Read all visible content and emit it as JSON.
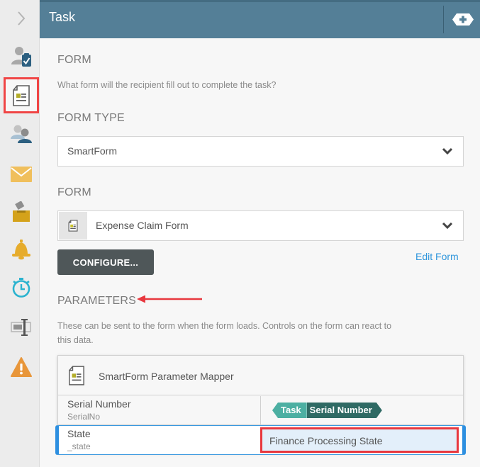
{
  "header": {
    "title": "Task",
    "add_button": "add-icon"
  },
  "sidebar": {
    "toggle": "chevron-right-icon",
    "items": [
      {
        "icon": "user-task-icon",
        "active": false
      },
      {
        "icon": "form-icon",
        "active": true
      },
      {
        "icon": "users-icon",
        "active": false
      },
      {
        "icon": "email-icon",
        "active": false
      },
      {
        "icon": "inbox-icon",
        "active": false
      },
      {
        "icon": "bell-icon",
        "active": false
      },
      {
        "icon": "stopwatch-icon",
        "active": false
      },
      {
        "icon": "text-field-icon",
        "active": false
      },
      {
        "icon": "warning-icon",
        "active": false
      }
    ]
  },
  "form_section": {
    "title": "FORM",
    "description": "What form will the recipient fill out to complete the task?"
  },
  "form_type": {
    "label": "FORM TYPE",
    "value": "SmartForm"
  },
  "form": {
    "label": "FORM",
    "value": "Expense Claim Form",
    "configure_label": "CONFIGURE...",
    "edit_link": "Edit Form"
  },
  "parameters": {
    "title": "PARAMETERS",
    "description_line1": "These can be sent to the form when the form loads. Controls on the form can react to",
    "description_line2": "this data.",
    "mapper_title": "SmartForm Parameter Mapper",
    "rows": [
      {
        "name": "Serial Number",
        "system_name": "SerialNo",
        "token_source": "Task",
        "token_value": "Serial Number"
      },
      {
        "name": "State",
        "system_name": "_state",
        "value": "Finance Processing State"
      }
    ]
  },
  "colors": {
    "header": "#547f97",
    "accent_link": "#2f96dc",
    "highlight": "#e8383f",
    "token_light": "#4cafa2",
    "token_dark": "#2f6a64"
  }
}
